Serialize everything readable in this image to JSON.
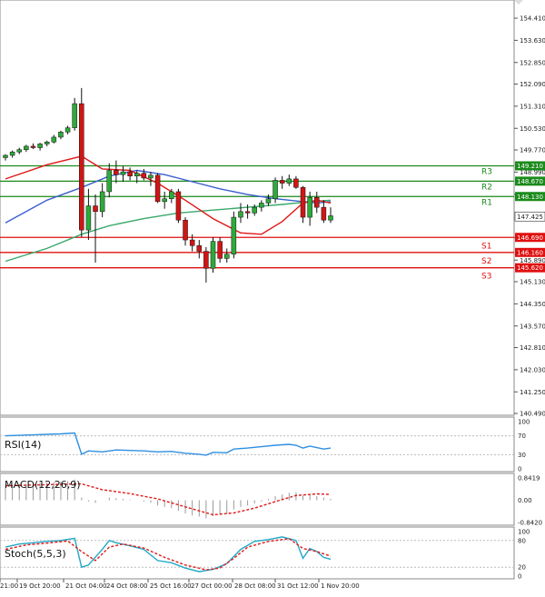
{
  "chart_data": {
    "type": "candlestick",
    "price_axis": {
      "range": [
        140.0,
        155.0
      ],
      "ticks": [
        "154.410",
        "153.630",
        "152.850",
        "152.090",
        "151.310",
        "150.530",
        "149.770",
        "148.990",
        "148.210",
        "147.425",
        "146.690",
        "145.890",
        "145.130",
        "144.350",
        "143.570",
        "142.810",
        "142.030",
        "141.250",
        "140.490"
      ]
    },
    "time_axis": {
      "labels": [
        "21:00",
        "19 Oct 20:00",
        "21 Oct 04:00",
        "24 Oct 08:00",
        "25 Oct 16:00",
        "27 Oct 00:00",
        "28 Oct 08:00",
        "31 Oct 12:00",
        "1 Nov 20:00"
      ]
    },
    "current_price": "147.425",
    "levels": [
      {
        "name": "R3",
        "value": 149.21,
        "label": "149.210",
        "color": "#1b8a1b"
      },
      {
        "name": "R2",
        "value": 148.67,
        "label": "148.670",
        "color": "#1b8a1b"
      },
      {
        "name": "R1",
        "value": 148.13,
        "label": "148.130",
        "color": "#1b8a1b"
      },
      {
        "name": "S1",
        "value": 146.69,
        "label": "146.690",
        "color": "#e01010"
      },
      {
        "name": "S2",
        "value": 146.16,
        "label": "146.160",
        "color": "#e01010"
      },
      {
        "name": "S3",
        "value": 145.62,
        "label": "145.620",
        "color": "#e01010"
      }
    ],
    "candles": [
      [
        149.5,
        149.62,
        149.4,
        149.58
      ],
      [
        149.58,
        149.75,
        149.5,
        149.7
      ],
      [
        149.7,
        149.85,
        149.62,
        149.78
      ],
      [
        149.78,
        149.95,
        149.7,
        149.9
      ],
      [
        149.9,
        150.0,
        149.8,
        149.85
      ],
      [
        149.85,
        150.02,
        149.75,
        149.98
      ],
      [
        149.98,
        150.1,
        149.9,
        150.05
      ],
      [
        150.05,
        150.3,
        150.0,
        150.22
      ],
      [
        150.22,
        150.45,
        150.15,
        150.4
      ],
      [
        150.4,
        150.62,
        150.32,
        150.55
      ],
      [
        150.55,
        151.6,
        150.45,
        151.4
      ],
      [
        151.4,
        151.95,
        146.7,
        146.95
      ],
      [
        146.95,
        148.4,
        146.6,
        147.8
      ],
      [
        147.8,
        148.2,
        145.8,
        147.6
      ],
      [
        147.6,
        148.6,
        147.4,
        148.3
      ],
      [
        148.3,
        149.3,
        148.1,
        149.05
      ],
      [
        149.05,
        149.4,
        148.6,
        148.9
      ],
      [
        148.9,
        149.2,
        148.65,
        149.0
      ],
      [
        149.0,
        149.15,
        148.7,
        148.85
      ],
      [
        148.85,
        149.05,
        148.6,
        148.95
      ],
      [
        148.95,
        149.1,
        148.7,
        148.78
      ],
      [
        148.78,
        149.0,
        148.5,
        148.88
      ],
      [
        148.88,
        148.95,
        147.9,
        147.95
      ],
      [
        147.95,
        148.3,
        147.7,
        148.05
      ],
      [
        148.05,
        148.4,
        147.9,
        148.3
      ],
      [
        148.3,
        148.4,
        147.2,
        147.3
      ],
      [
        147.3,
        147.4,
        146.4,
        146.6
      ],
      [
        146.6,
        146.8,
        146.2,
        146.4
      ],
      [
        146.4,
        146.6,
        145.95,
        146.2
      ],
      [
        146.2,
        146.35,
        145.1,
        145.6
      ],
      [
        145.6,
        146.7,
        145.45,
        146.55
      ],
      [
        146.55,
        146.7,
        145.8,
        145.95
      ],
      [
        145.95,
        146.3,
        145.8,
        146.1
      ],
      [
        146.1,
        147.6,
        145.95,
        147.4
      ],
      [
        147.4,
        147.9,
        147.2,
        147.6
      ],
      [
        147.6,
        147.85,
        147.35,
        147.55
      ],
      [
        147.55,
        147.85,
        147.45,
        147.75
      ],
      [
        147.75,
        148.0,
        147.6,
        147.9
      ],
      [
        147.9,
        148.2,
        147.8,
        148.05
      ],
      [
        148.05,
        148.8,
        147.9,
        148.7
      ],
      [
        148.7,
        148.85,
        148.4,
        148.6
      ],
      [
        148.6,
        148.9,
        148.5,
        148.75
      ],
      [
        148.75,
        148.85,
        148.4,
        148.45
      ],
      [
        148.45,
        148.5,
        147.2,
        147.4
      ],
      [
        147.4,
        148.3,
        147.1,
        148.1
      ],
      [
        148.1,
        148.3,
        147.55,
        147.75
      ],
      [
        147.75,
        148.0,
        147.2,
        147.3
      ],
      [
        147.3,
        147.75,
        147.2,
        147.45
      ]
    ],
    "ma_red": [
      [
        0,
        148.75
      ],
      [
        6,
        149.25
      ],
      [
        11,
        149.55
      ],
      [
        14,
        149.1
      ],
      [
        18,
        149.05
      ],
      [
        22,
        148.6
      ],
      [
        26,
        148.0
      ],
      [
        30,
        147.35
      ],
      [
        34,
        146.85
      ],
      [
        37,
        146.8
      ],
      [
        40,
        147.25
      ],
      [
        43,
        147.9
      ],
      [
        45,
        148.0
      ],
      [
        47,
        147.9
      ]
    ],
    "ma_blue": [
      [
        0,
        147.2
      ],
      [
        6,
        148.0
      ],
      [
        11,
        148.45
      ],
      [
        15,
        148.85
      ],
      [
        19,
        149.05
      ],
      [
        23,
        148.9
      ],
      [
        27,
        148.65
      ],
      [
        31,
        148.4
      ],
      [
        35,
        148.2
      ],
      [
        39,
        148.05
      ],
      [
        43,
        147.95
      ],
      [
        45,
        147.9
      ],
      [
        47,
        147.95
      ]
    ],
    "ma_green": [
      [
        0,
        145.85
      ],
      [
        6,
        146.3
      ],
      [
        11,
        146.8
      ],
      [
        15,
        147.1
      ],
      [
        20,
        147.35
      ],
      [
        25,
        147.55
      ],
      [
        30,
        147.65
      ],
      [
        35,
        147.75
      ],
      [
        40,
        147.85
      ],
      [
        44,
        147.95
      ],
      [
        47,
        148.0
      ]
    ],
    "rsi": {
      "title": "RSI(14)",
      "ticks": [
        "100",
        "70",
        "30",
        "0"
      ],
      "values": [
        [
          0,
          70
        ],
        [
          2,
          71
        ],
        [
          4,
          72
        ],
        [
          6,
          73
        ],
        [
          8,
          74
        ],
        [
          10,
          76
        ],
        [
          11,
          31
        ],
        [
          12,
          38
        ],
        [
          14,
          36
        ],
        [
          16,
          40
        ],
        [
          18,
          39
        ],
        [
          20,
          38
        ],
        [
          22,
          36
        ],
        [
          24,
          37
        ],
        [
          26,
          33
        ],
        [
          28,
          31
        ],
        [
          29,
          29
        ],
        [
          30,
          35
        ],
        [
          32,
          34
        ],
        [
          33,
          42
        ],
        [
          35,
          44
        ],
        [
          37,
          47
        ],
        [
          39,
          50
        ],
        [
          41,
          52
        ],
        [
          42,
          50
        ],
        [
          43,
          44
        ],
        [
          44,
          48
        ],
        [
          45,
          45
        ],
        [
          46,
          42
        ],
        [
          47,
          44
        ]
      ]
    },
    "macd": {
      "title": "MACD(12,26,9)",
      "ticks": [
        "0.8419",
        "0.00",
        "-0.8420"
      ],
      "histogram": [
        0.55,
        0.58,
        0.6,
        0.62,
        0.63,
        0.64,
        0.66,
        0.68,
        0.7,
        0.72,
        0.78,
        0.1,
        -0.05,
        -0.1,
        0.0,
        0.1,
        0.08,
        0.05,
        0.02,
        0.0,
        -0.05,
        -0.1,
        -0.2,
        -0.25,
        -0.3,
        -0.4,
        -0.5,
        -0.58,
        -0.62,
        -0.68,
        -0.6,
        -0.55,
        -0.5,
        -0.35,
        -0.25,
        -0.2,
        -0.12,
        -0.05,
        0.05,
        0.15,
        0.22,
        0.28,
        0.3,
        0.18,
        0.2,
        0.15,
        0.1,
        0.05
      ],
      "signal": [
        [
          0,
          0.55
        ],
        [
          11,
          0.62
        ],
        [
          14,
          0.4
        ],
        [
          18,
          0.25
        ],
        [
          22,
          0.05
        ],
        [
          26,
          -0.25
        ],
        [
          30,
          -0.55
        ],
        [
          33,
          -0.48
        ],
        [
          36,
          -0.3
        ],
        [
          39,
          -0.05
        ],
        [
          42,
          0.18
        ],
        [
          45,
          0.24
        ],
        [
          47,
          0.22
        ]
      ]
    },
    "stoch": {
      "title": "Stoch(5,5,3)",
      "ticks": [
        "100",
        "80",
        "20",
        "0"
      ],
      "k": [
        [
          0,
          65
        ],
        [
          2,
          72
        ],
        [
          4,
          75
        ],
        [
          6,
          78
        ],
        [
          8,
          80
        ],
        [
          10,
          85
        ],
        [
          11,
          20
        ],
        [
          12,
          25
        ],
        [
          14,
          60
        ],
        [
          15,
          80
        ],
        [
          16,
          75
        ],
        [
          18,
          68
        ],
        [
          20,
          60
        ],
        [
          22,
          35
        ],
        [
          24,
          30
        ],
        [
          26,
          18
        ],
        [
          28,
          10
        ],
        [
          30,
          15
        ],
        [
          32,
          28
        ],
        [
          34,
          60
        ],
        [
          36,
          78
        ],
        [
          38,
          82
        ],
        [
          40,
          88
        ],
        [
          42,
          80
        ],
        [
          43,
          40
        ],
        [
          44,
          62
        ],
        [
          45,
          55
        ],
        [
          46,
          42
        ],
        [
          47,
          38
        ]
      ],
      "d": [
        [
          0,
          60
        ],
        [
          3,
          70
        ],
        [
          6,
          74
        ],
        [
          9,
          79
        ],
        [
          11,
          55
        ],
        [
          13,
          35
        ],
        [
          15,
          65
        ],
        [
          17,
          72
        ],
        [
          20,
          63
        ],
        [
          23,
          42
        ],
        [
          26,
          25
        ],
        [
          29,
          14
        ],
        [
          31,
          18
        ],
        [
          33,
          40
        ],
        [
          35,
          65
        ],
        [
          38,
          78
        ],
        [
          41,
          84
        ],
        [
          43,
          62
        ],
        [
          45,
          55
        ],
        [
          47,
          45
        ]
      ]
    }
  }
}
